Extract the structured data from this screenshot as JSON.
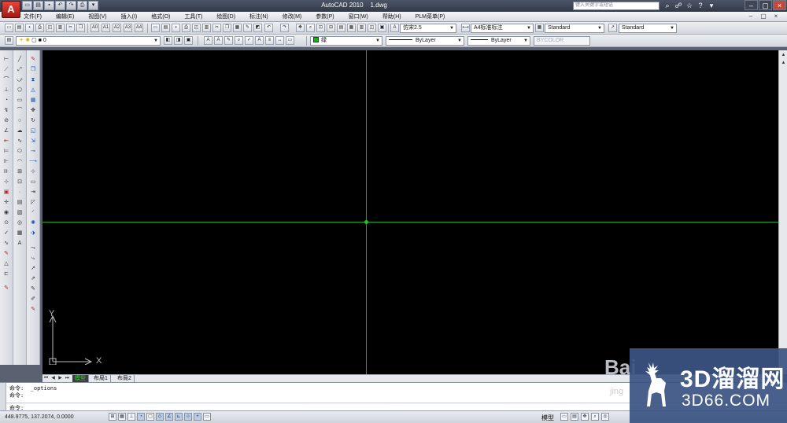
{
  "title_bar": {
    "title": "AutoCAD 2010    1.dwg",
    "search_placeholder": "键入关键字或短语"
  },
  "menu": {
    "items": [
      "文件(F)",
      "编辑(E)",
      "视图(V)",
      "插入(I)",
      "格式(O)",
      "工具(T)",
      "绘图(D)",
      "标注(N)",
      "修改(M)",
      "参数(P)",
      "窗口(W)",
      "帮助(H)",
      "PLM菜单(P)"
    ]
  },
  "toolbar1": {
    "text_styles": [
      "A0",
      "A1",
      "A2",
      "A3",
      "A4"
    ],
    "text_style_combo": "仿宋2.5",
    "dim_style_combo": "A4标准标注",
    "table_style_combo": "Standard",
    "multileader_style_combo": "Standard"
  },
  "toolbar2": {
    "layer_combo": "0",
    "color_combo": "绿",
    "linetype_combo": "ByLayer",
    "lineweight_combo": "ByLayer",
    "plotstyle_combo": "BYCOLOR"
  },
  "drawing": {
    "ucs_x_label": "X",
    "ucs_y_label": "Y",
    "crosshair_color": "#1fa51f"
  },
  "layout_tabs": [
    "模型",
    "布局1",
    "布局2"
  ],
  "command": {
    "lines": [
      "命令:  _options",
      "命令:",
      "命令:"
    ]
  },
  "status": {
    "coordinates": "448.9775, 137.2074, 0.0000",
    "model_label": "模型"
  },
  "watermark": {
    "brand_cn": "3D溜溜网",
    "brand_en": "3D66.COM",
    "behind_text": "Bai",
    "behind_small": "jing"
  }
}
